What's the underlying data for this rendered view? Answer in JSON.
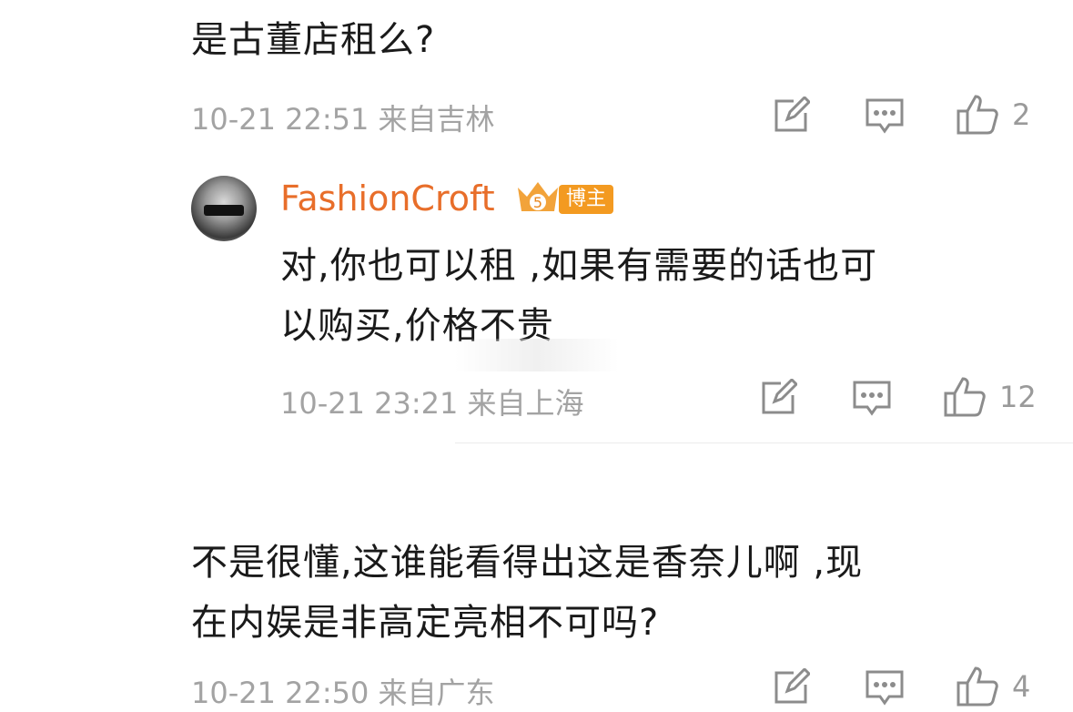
{
  "comments": [
    {
      "text": "是古董店租么?",
      "meta": "10-21 22:51 来自吉林",
      "likes": "2"
    },
    {
      "user": "FashionCroft",
      "badge": "博主",
      "text_line1": "对,你也可以租 ,如果有需要的话也可",
      "text_line2": "以购买,价格不贵",
      "meta": "10-21 23:21 来自上海",
      "likes": "12"
    },
    {
      "text_line1": "不是很懂,这谁能看得出这是香奈儿啊 ,现",
      "text_line2": "在内娱是非高定亮相不可吗?",
      "meta": "10-21 22:50 来自广东",
      "likes": "4"
    }
  ],
  "colors": {
    "username": "#e86e2a",
    "badge": "#f39a21",
    "meta": "#a3a3a3"
  },
  "icons": [
    "edit-icon",
    "comment-icon",
    "thumbs-up-icon",
    "crown-badge-icon"
  ]
}
